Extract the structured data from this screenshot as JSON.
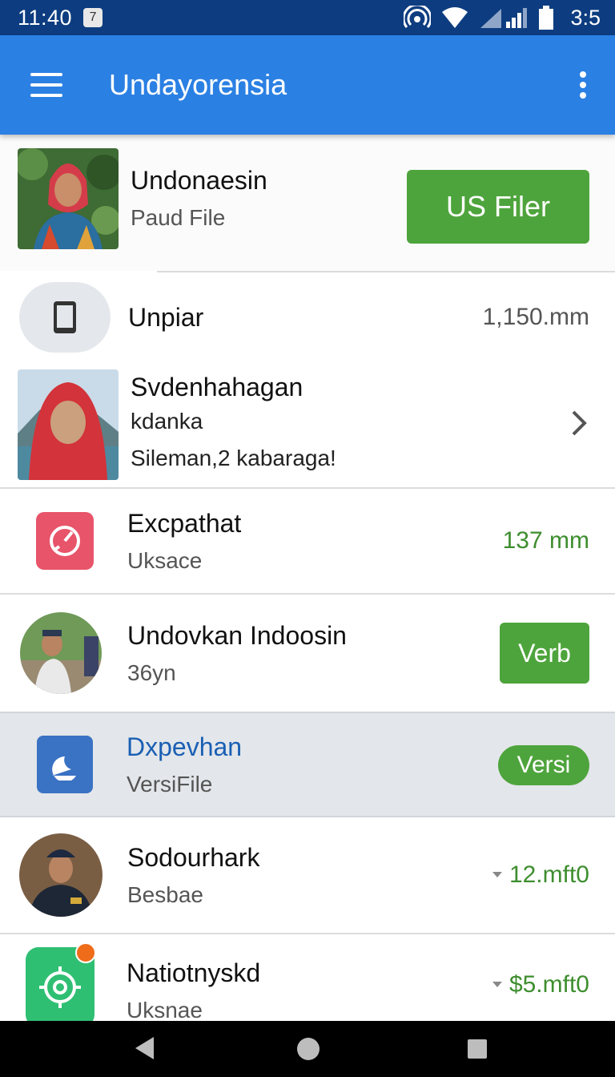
{
  "status_bar": {
    "time": "11:40",
    "badge": "7",
    "clock": "3:5",
    "icons": [
      "hotspot-icon",
      "wifi-icon",
      "signal-icon",
      "battery-icon"
    ]
  },
  "app_bar": {
    "title": "Undayorensia",
    "menu_icon": "hamburger-menu-icon",
    "more_icon": "overflow-menu-icon"
  },
  "colors": {
    "status_bar": "#0d3d80",
    "app_bar": "#2b80e3",
    "accent_green": "#4ea43c",
    "highlight_row": "#e3e6ea",
    "link_blue": "#1a5fb4"
  },
  "list": [
    {
      "title": "Undonaesin",
      "subtitle": "Paud File",
      "action": "US Filer"
    },
    {
      "title": "Unpiar",
      "value": "1,150.mm",
      "icon": "phone-icon"
    },
    {
      "title": "Svdenhahagan",
      "subtitle": "kdanka",
      "detail": "Sileman,2 kabaraga!",
      "icon": "chevron-right-icon"
    },
    {
      "title": "Excpathat",
      "subtitle": "Uksace",
      "value": "137 mm",
      "icon": "gauge-app-icon"
    },
    {
      "title": "Undovkan Indoosin",
      "subtitle": "36yn",
      "action": "Verb"
    },
    {
      "title": "Dxpevhan",
      "subtitle": "VersiFile",
      "action": "Versi",
      "icon": "moon-app-icon"
    },
    {
      "title": "Sodourhark",
      "subtitle": "Besbae",
      "value": "12.mft0",
      "icon": "caret-down-icon"
    },
    {
      "title": "Natiotnyskd",
      "subtitle": "Uksnae",
      "value": "$5.mft0",
      "icon": "settings-app-icon"
    }
  ],
  "nav_bar": {
    "icons": [
      "back-icon",
      "home-icon",
      "recents-icon"
    ]
  }
}
